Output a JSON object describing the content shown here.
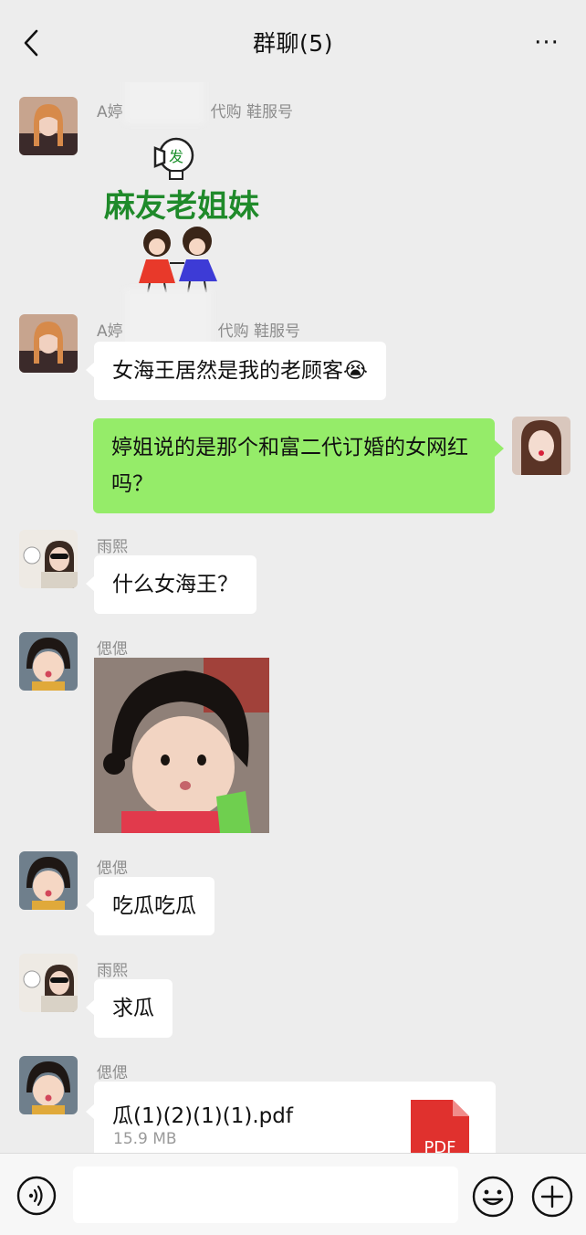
{
  "header": {
    "title": "群聊(5)",
    "more_label": "···"
  },
  "messages": {
    "m1": {
      "nick_a": "A婷",
      "nick_b": "代购 鞋服号",
      "sticker_text": "麻友老姐妹",
      "sticker_badge": "发"
    },
    "m2": {
      "nick_a": "A婷",
      "nick_b": "代购 鞋服号",
      "text": "女海王居然是我的老顾客😭"
    },
    "m3": {
      "text": "婷姐说的是那个和富二代订婚的女网红吗？"
    },
    "m4": {
      "nick": "雨熙",
      "text": "什么女海王？"
    },
    "m5": {
      "nick": "偲偲"
    },
    "m6": {
      "nick": "偲偲",
      "text": "吃瓜吃瓜"
    },
    "m7": {
      "nick": "雨熙",
      "text": "求瓜"
    },
    "m8": {
      "nick": "偲偲",
      "file_name": "瓜(1)(2)(1)(1).pdf",
      "file_size": "15.9 MB",
      "file_type": "PDF"
    }
  },
  "icons": [
    "back-icon",
    "more-icon",
    "voice-icon",
    "emoji-icon",
    "plus-icon",
    "pdf-icon"
  ],
  "colors": {
    "my_bubble": "#95ec69",
    "background": "#ededed",
    "pdf_red": "#e0312e"
  }
}
